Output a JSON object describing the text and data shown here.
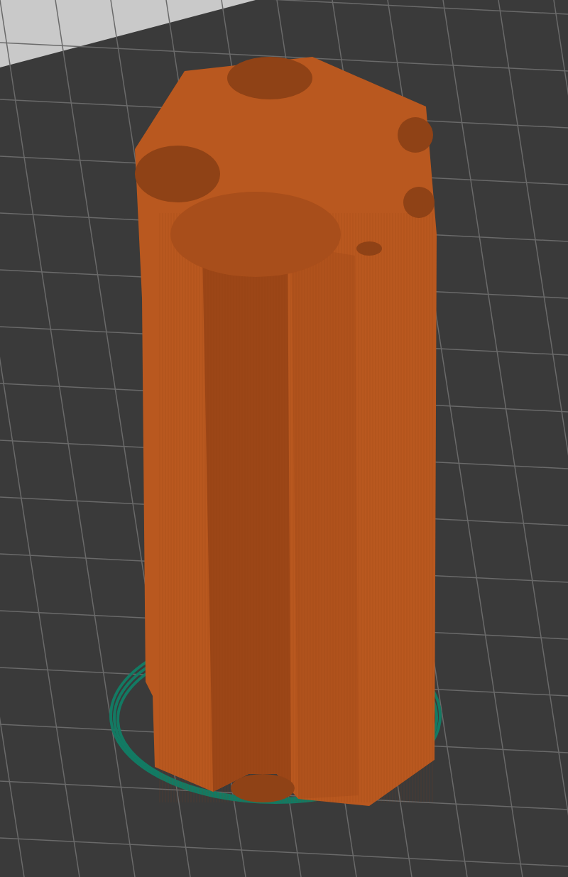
{
  "features": [
    {
      "kind": "object",
      "color": "#b9581f"
    },
    {
      "kind": "skirt",
      "color": "#137a63"
    }
  ]
}
